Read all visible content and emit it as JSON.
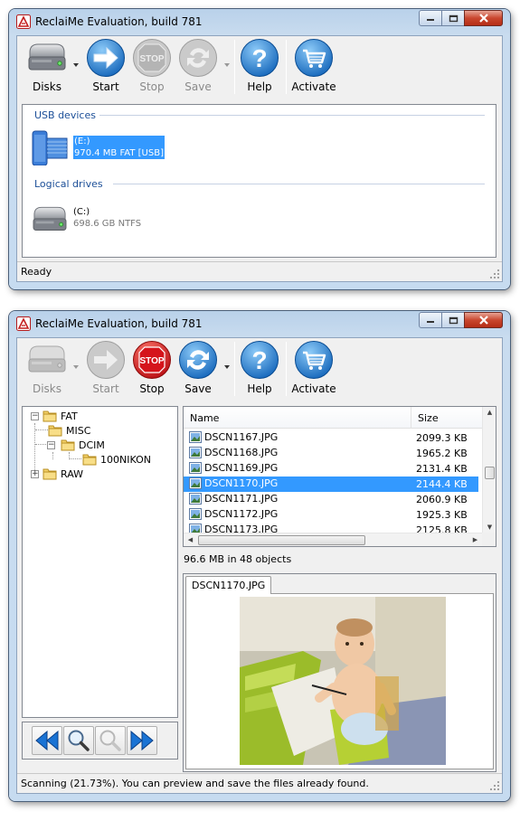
{
  "window1": {
    "title": "ReclaiMe Evaluation, build 781",
    "toolbar": [
      {
        "label": "Disks",
        "enabled": true,
        "icon": "hard-drive-icon",
        "dropdown": true
      },
      {
        "label": "Start",
        "enabled": true,
        "icon": "arrow-right-icon"
      },
      {
        "label": "Stop",
        "enabled": false,
        "icon": "stop-sign-icon"
      },
      {
        "label": "Save",
        "enabled": false,
        "icon": "save-arrows-icon",
        "dropdown": true
      },
      {
        "label": "Help",
        "enabled": true,
        "icon": "question-icon"
      },
      {
        "label": "Activate",
        "enabled": true,
        "icon": "cart-icon"
      }
    ],
    "groups": [
      {
        "header": "USB devices",
        "drives": [
          {
            "name": "(E:)",
            "info": "970.4 MB FAT [USB]",
            "selected": true
          }
        ]
      },
      {
        "header": "Logical drives",
        "drives": [
          {
            "name": "(C:)",
            "info": "698.6 GB NTFS",
            "selected": false
          }
        ]
      }
    ],
    "status": "Ready"
  },
  "window2": {
    "title": "ReclaiMe Evaluation, build 781",
    "toolbar": [
      {
        "label": "Disks",
        "enabled": false,
        "icon": "hard-drive-icon",
        "dropdown": true
      },
      {
        "label": "Start",
        "enabled": false,
        "icon": "arrow-right-icon"
      },
      {
        "label": "Stop",
        "enabled": true,
        "icon": "stop-sign-icon"
      },
      {
        "label": "Save",
        "enabled": true,
        "icon": "save-arrows-icon",
        "dropdown": true
      },
      {
        "label": "Help",
        "enabled": true,
        "icon": "question-icon"
      },
      {
        "label": "Activate",
        "enabled": true,
        "icon": "cart-icon"
      }
    ],
    "stop_sign_text": "STOP",
    "tree": [
      {
        "label": "FAT",
        "expander": "−"
      },
      {
        "label": "MISC",
        "expander": ""
      },
      {
        "label": "DCIM",
        "expander": "−"
      },
      {
        "label": "100NIKON",
        "expander": ""
      },
      {
        "label": "RAW",
        "expander": "+"
      }
    ],
    "list": {
      "columns": [
        "Name",
        "Size"
      ],
      "rows": [
        {
          "name": "DSCN1167.JPG",
          "size": "2099.3 KB",
          "selected": false
        },
        {
          "name": "DSCN1168.JPG",
          "size": "1965.2 KB",
          "selected": false
        },
        {
          "name": "DSCN1169.JPG",
          "size": "2131.4 KB",
          "selected": false
        },
        {
          "name": "DSCN1170.JPG",
          "size": "2144.4 KB",
          "selected": true
        },
        {
          "name": "DSCN1171.JPG",
          "size": "2060.9 KB",
          "selected": false
        },
        {
          "name": "DSCN1172.JPG",
          "size": "1925.3 KB",
          "selected": false
        },
        {
          "name": "DSCN1173.JPG",
          "size": "2125.8 KB",
          "selected": false
        }
      ],
      "summary": "96.6 MB in 48 objects"
    },
    "preview_tab": "DSCN1170.JPG",
    "nav_buttons": [
      "rewind-icon",
      "zoom-icon",
      "zoom-disabled-icon",
      "fast-forward-icon"
    ],
    "status": "Scanning (21.73%). You can preview and save the files already found."
  },
  "colors": {
    "accent": "#3399ff",
    "group_header": "#1c4f98",
    "stop_red": "#d5141b"
  }
}
